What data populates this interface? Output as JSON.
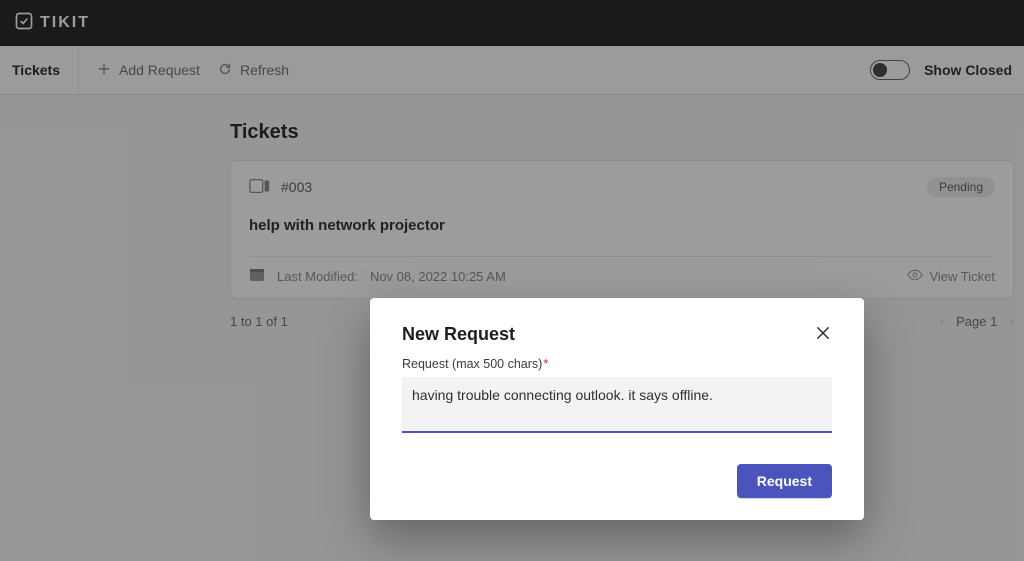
{
  "brand": {
    "name": "TIKIT"
  },
  "toolbar": {
    "tab_tickets": "Tickets",
    "add_request": "Add Request",
    "refresh": "Refresh",
    "show_closed": "Show Closed"
  },
  "page": {
    "title": "Tickets"
  },
  "ticket": {
    "id": "#003",
    "status": "Pending",
    "title": "help with network projector",
    "modified_label": "Last Modified:",
    "modified_value": "Nov 08, 2022 10:25 AM",
    "view_label": "View Ticket"
  },
  "pager": {
    "range": "1 to 1 of 1",
    "page_label": "Page 1"
  },
  "modal": {
    "title": "New Request",
    "field_label": "Request (max 500 chars)",
    "field_placeholder": "",
    "field_value": "having trouble connecting outlook. it says offline.",
    "submit_label": "Request"
  }
}
